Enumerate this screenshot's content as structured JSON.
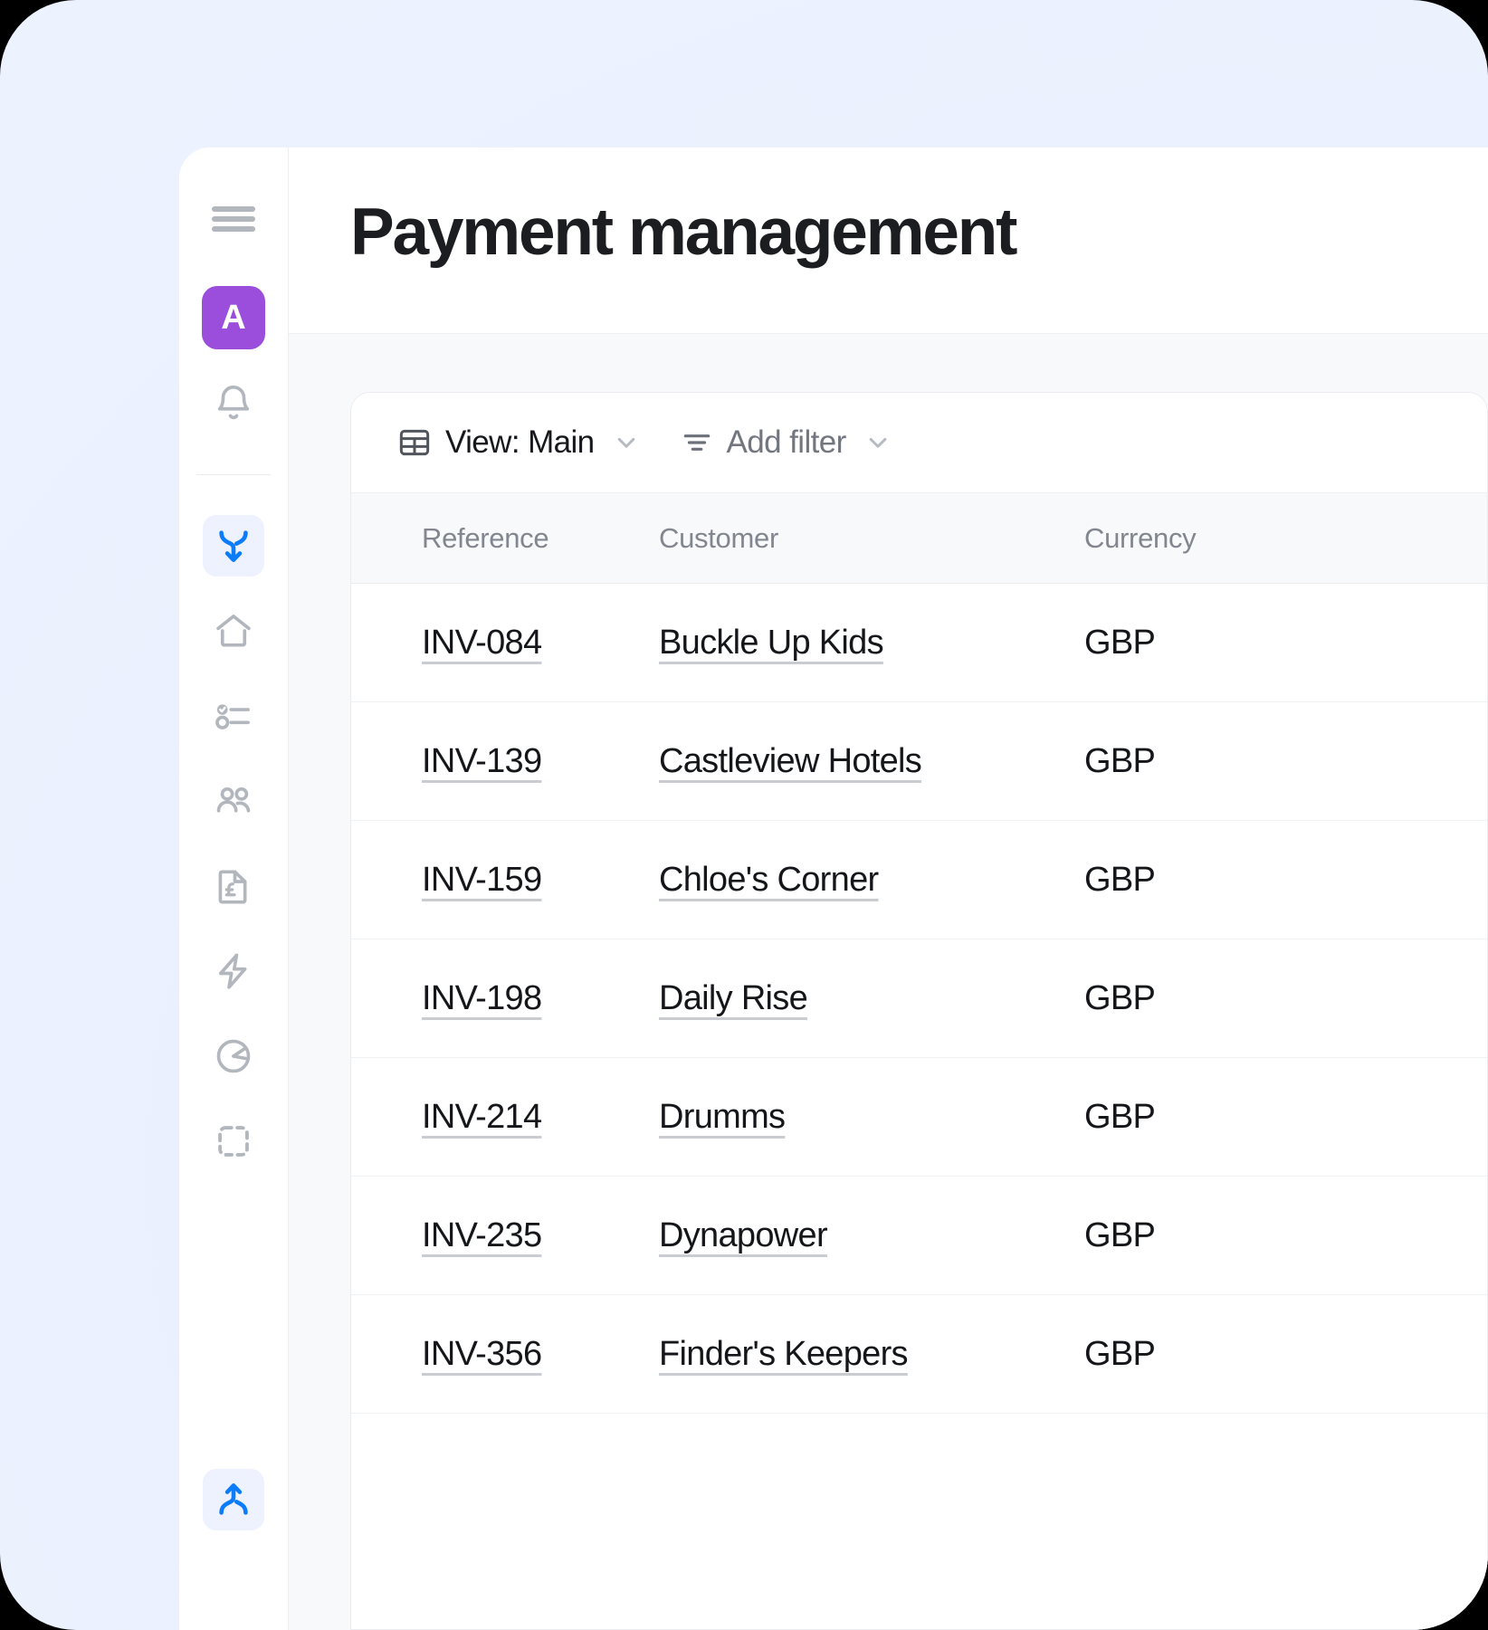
{
  "window": {
    "title": "Payment management"
  },
  "sidebar": {
    "menu_icon": "hamburger-menu-icon",
    "brand": {
      "label": "A",
      "name": "workspace-avatar",
      "color": "#9b4ddb"
    },
    "items": [
      {
        "icon": "bell-icon",
        "name": "notifications",
        "active": false
      },
      {
        "icon": "merge-down-icon",
        "name": "flows",
        "active": true
      },
      {
        "icon": "home-icon",
        "name": "home",
        "active": false
      },
      {
        "icon": "checklist-icon",
        "name": "tasks",
        "active": false
      },
      {
        "icon": "people-icon",
        "name": "contacts",
        "active": false
      },
      {
        "icon": "invoice-gbp-icon",
        "name": "invoices",
        "active": false
      },
      {
        "icon": "lightning-icon",
        "name": "automations",
        "active": false
      },
      {
        "icon": "pie-chart-icon",
        "name": "reports",
        "active": false
      },
      {
        "icon": "dashed-square-icon",
        "name": "integrations",
        "active": false
      }
    ],
    "bottom_item": {
      "icon": "merge-up-icon",
      "name": "collapse-rail",
      "active": true
    }
  },
  "toolbar": {
    "view_icon": "table-grid-icon",
    "view_label": "View: Main",
    "view_chevron": "chevron-down-icon",
    "filter_icon": "filter-lines-icon",
    "filter_label": "Add filter",
    "filter_chevron": "chevron-down-icon"
  },
  "table": {
    "columns": [
      {
        "key": "reference",
        "label": "Reference"
      },
      {
        "key": "customer",
        "label": "Customer"
      },
      {
        "key": "currency",
        "label": "Currency"
      }
    ],
    "rows": [
      {
        "reference": "INV-084",
        "customer": "Buckle Up Kids",
        "currency": "GBP"
      },
      {
        "reference": "INV-139",
        "customer": "Castleview Hotels",
        "currency": "GBP"
      },
      {
        "reference": "INV-159",
        "customer": "Chloe's Corner",
        "currency": "GBP"
      },
      {
        "reference": "INV-198",
        "customer": "Daily Rise",
        "currency": "GBP"
      },
      {
        "reference": "INV-214",
        "customer": "Drumms",
        "currency": "GBP"
      },
      {
        "reference": "INV-235",
        "customer": "Dynapower",
        "currency": "GBP"
      },
      {
        "reference": "INV-356",
        "customer": "Finder's Keepers",
        "currency": "GBP"
      }
    ]
  },
  "colors": {
    "brand_purple": "#9b4ddb",
    "accent_blue": "#0b7cfb",
    "accent_blue_bg": "#eef1fe",
    "backdrop_blue": "#d2e2fd",
    "text_primary": "#14161a",
    "text_muted": "#82868e"
  }
}
